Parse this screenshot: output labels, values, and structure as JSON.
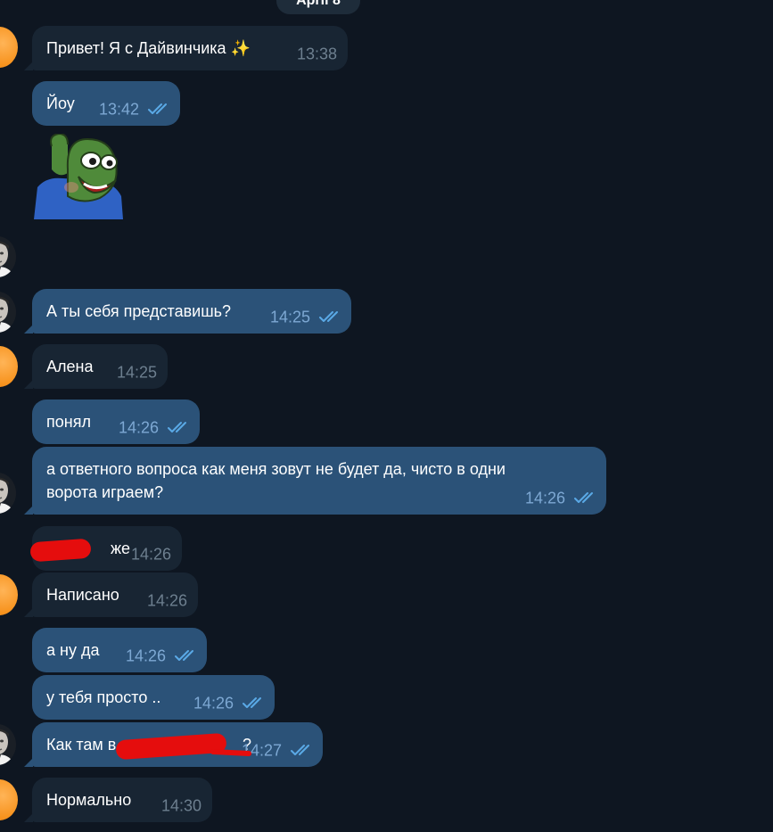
{
  "chat": {
    "date": "April 8",
    "colors": {
      "background": "#0e1621",
      "incoming_bubble": "#182533",
      "outgoing_bubble": "#2b5278",
      "read_checks": "#5aa9e6",
      "incoming_avatar": "#f7931e",
      "redaction": "#e50d0d"
    },
    "sticker": {
      "icon": "pepe-frog-sticker"
    },
    "messages": [
      {
        "text": "Привет! Я с Дайвинчика",
        "emoji": "✨",
        "time": "13:38",
        "direction": "in"
      },
      {
        "text": "Йоу",
        "time": "13:42",
        "direction": "out",
        "status": "read"
      },
      {
        "text": "А ты себя представишь?",
        "time": "14:25",
        "direction": "out",
        "status": "read"
      },
      {
        "text": "Алена",
        "time": "14:25",
        "direction": "in"
      },
      {
        "text": "понял",
        "time": "14:26",
        "direction": "out",
        "status": "read"
      },
      {
        "text_line1": "а ответного вопроса как меня зовут не будет да, чисто в одни",
        "text_line2": "ворота играем?",
        "time": "14:26",
        "direction": "out",
        "status": "read"
      },
      {
        "text": "же",
        "time": "14:26",
        "direction": "in",
        "redacted": true
      },
      {
        "text": "Написано",
        "time": "14:26",
        "direction": "in"
      },
      {
        "text": "а ну да",
        "time": "14:26",
        "direction": "out",
        "status": "read"
      },
      {
        "text": "у тебя просто ..",
        "time": "14:26",
        "direction": "out",
        "status": "read"
      },
      {
        "text_start": "Как там в",
        "text_end": "?",
        "time": "14:27",
        "direction": "out",
        "status": "read",
        "redacted": true
      },
      {
        "text": "Нормально",
        "time": "14:30",
        "direction": "in"
      }
    ]
  }
}
